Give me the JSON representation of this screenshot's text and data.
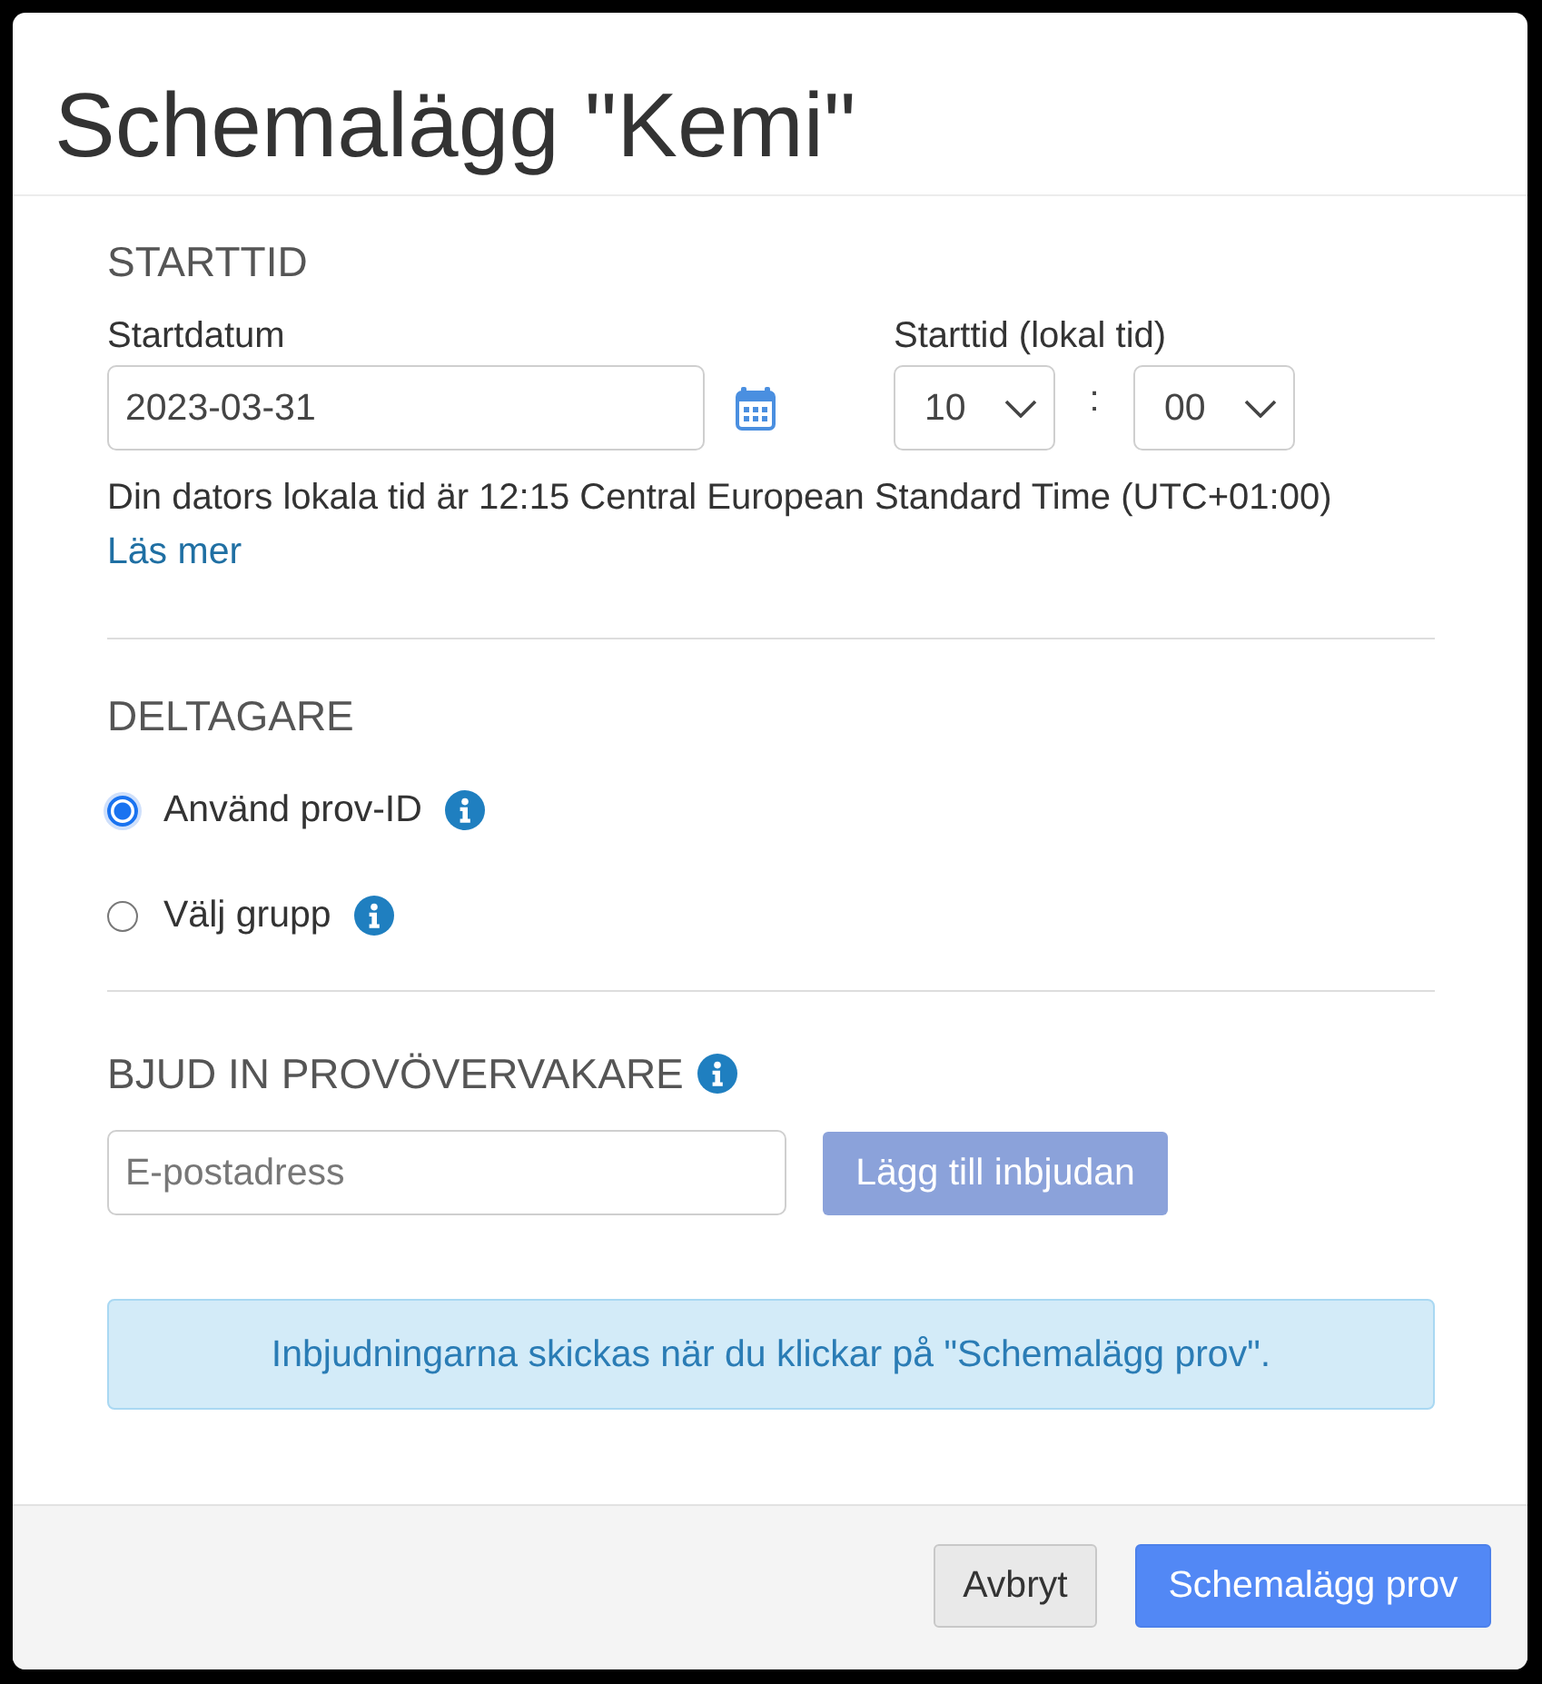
{
  "dialog": {
    "title": "Schemalägg \"Kemi\""
  },
  "start_time": {
    "heading": "STARTTID",
    "date_label": "Startdatum",
    "date_value": "2023-03-31",
    "time_label": "Starttid (lokal tid)",
    "hour": "10",
    "separator": ":",
    "minute": "00",
    "note": "Din dators lokala tid är 12:15 Central European Standard Time (UTC+01:00)",
    "link": "Läs mer"
  },
  "participants": {
    "heading": "DELTAGARE",
    "options": [
      {
        "label": "Använd prov-ID",
        "selected": true
      },
      {
        "label": "Välj grupp",
        "selected": false
      }
    ]
  },
  "invite": {
    "heading": "BJUD IN PROVÖVERVAKARE",
    "email_placeholder": "E-postadress",
    "add_button": {
      "label": "Lägg till inbjudan",
      "disabled": true
    },
    "alert": "Inbjudningarna skickas när du klickar på \"Schemalägg prov\"."
  },
  "footer": {
    "buttons": [
      {
        "label": "Avbryt",
        "kind": "secondary"
      },
      {
        "label": "Schemalägg prov",
        "kind": "primary"
      }
    ]
  }
}
